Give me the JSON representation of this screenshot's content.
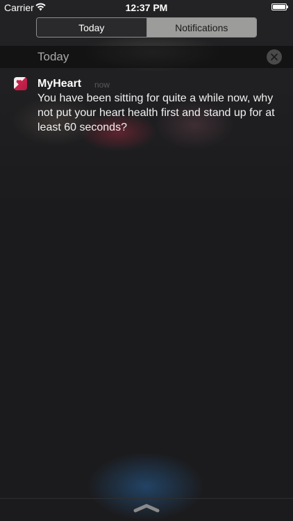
{
  "status_bar": {
    "carrier": "Carrier",
    "time": "12:37 PM",
    "wifi_icon": "wifi-icon",
    "battery_icon": "battery-icon"
  },
  "segmented_control": {
    "tabs": [
      {
        "label": "Today",
        "selected": false
      },
      {
        "label": "Notifications",
        "selected": true
      }
    ]
  },
  "section": {
    "title": "Today",
    "clear_icon": "close-icon"
  },
  "notification": {
    "app_name": "MyHeart",
    "time": "now",
    "message": "You have been sitting for quite a while now, why not put your heart health first and stand up for at least 60 seconds?",
    "icon": "heart-app-icon"
  },
  "colors": {
    "background": "#1b1b1d",
    "segment_selected": "#9c9c9a",
    "app_accent": "#c8214a"
  }
}
